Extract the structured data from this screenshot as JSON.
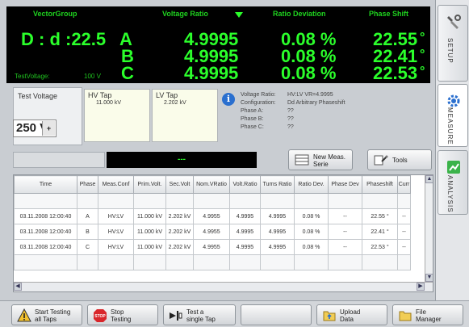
{
  "display": {
    "headers": [
      "VectorGroup",
      "Voltage Ratio",
      "Ratio Deviation",
      "Phase Shift"
    ],
    "vector_group": "D : d :22.5",
    "phase_labels": [
      "A",
      "B",
      "C"
    ],
    "voltage_ratios": [
      "4.9995",
      "4.9995",
      "4.9995"
    ],
    "ratio_deviations": [
      "0.08 %",
      "0.08 %",
      "0.08 %"
    ],
    "phase_shifts": [
      "22.55",
      "22.41",
      "22.53"
    ],
    "degree": "°",
    "test_voltage_label": "TestVoltage:",
    "test_voltage_value": "100 V"
  },
  "side_tabs": [
    "SETUP",
    "MEASURE",
    "ANALYSIS"
  ],
  "settings": {
    "test_voltage_label": "Test Voltage",
    "test_voltage_value": "250 V",
    "select_arrow": "+",
    "hv_tap_label": "HV Tap",
    "hv_tap_value": "11.000 kV",
    "lv_tap_label": "LV Tap",
    "lv_tap_value": "2.202 kV",
    "info_glyph": "i",
    "info": [
      {
        "key": "Voltage Ratio:",
        "value": "HV:LV VR=4.9995"
      },
      {
        "key": "Configuration:",
        "value": "Dd Arbitrary Phaseshift"
      },
      {
        "key": "Phase A:",
        "value": "??"
      },
      {
        "key": "Phase B:",
        "value": "??"
      },
      {
        "key": "Phase C:",
        "value": "??"
      }
    ]
  },
  "progress": {
    "text": "---"
  },
  "buttons": {
    "new_meas_line1": "New Meas.",
    "new_meas_line2": "Serie",
    "tools": "Tools"
  },
  "table": {
    "headers": [
      "Time",
      "Phase",
      "Meas.Conf",
      "Prim.Volt.",
      "Sec.Volt",
      "Nom.VRatio",
      "Volt.Ratio",
      "Turns Ratio",
      "Ratio Dev.",
      "Phase Dev",
      "Phaseshift",
      "Curr"
    ],
    "rows": [
      [
        "03.11.2008 12:00:40",
        "A",
        "HV:LV",
        "11.000 kV",
        "2.202 kV",
        "4.9955",
        "4.9995",
        "4.9995",
        "0.08 %",
        "--",
        "22.55 °",
        "--"
      ],
      [
        "03.11.2008 12:00:40",
        "B",
        "HV:LV",
        "11.000 kV",
        "2.202 kV",
        "4.9955",
        "4.9995",
        "4.9995",
        "0.08 %",
        "--",
        "22.41 °",
        "--"
      ],
      [
        "03.11.2008 12:00:40",
        "C",
        "HV:LV",
        "11.000 kV",
        "2.202 kV",
        "4.9955",
        "4.9995",
        "4.9995",
        "0.08 %",
        "--",
        "22.53 °",
        "--"
      ]
    ]
  },
  "bottom": {
    "start_line1": "Start Testing",
    "start_line2": "all Taps",
    "stop_line1": "Stop",
    "stop_line2": "Testing",
    "stop_icon_text": "STOP",
    "single_line1": "Test a",
    "single_line2": "single Tap",
    "upload_line1": "Upload",
    "upload_line2": "Data",
    "file_line1": "File",
    "file_line2": "Manager"
  }
}
